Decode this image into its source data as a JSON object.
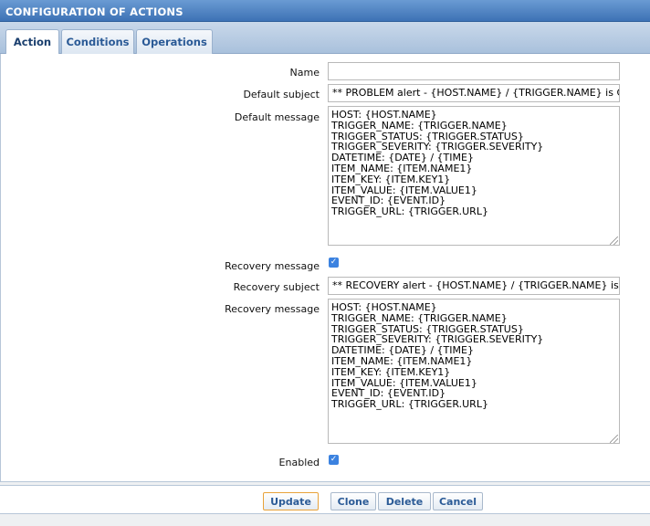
{
  "header": {
    "title": "CONFIGURATION OF ACTIONS"
  },
  "tabs": [
    {
      "label": "Action",
      "active": true
    },
    {
      "label": "Conditions",
      "active": false
    },
    {
      "label": "Operations",
      "active": false
    }
  ],
  "form": {
    "name": {
      "label": "Name",
      "value": ""
    },
    "default_subject": {
      "label": "Default subject",
      "value": "** PROBLEM alert - {HOST.NAME} / {TRIGGER.NAME} is CRI"
    },
    "default_message": {
      "label": "Default message",
      "value": "HOST: {HOST.NAME}\nTRIGGER_NAME: {TRIGGER.NAME}\nTRIGGER_STATUS: {TRIGGER.STATUS}\nTRIGGER_SEVERITY: {TRIGGER.SEVERITY}\nDATETIME: {DATE} / {TIME}\nITEM_NAME: {ITEM.NAME1}\nITEM_KEY: {ITEM.KEY1}\nITEM_VALUE: {ITEM.VALUE1}\nEVENT_ID: {EVENT.ID}\nTRIGGER_URL: {TRIGGER.URL}"
    },
    "recovery_message_toggle": {
      "label": "Recovery message",
      "checked": true
    },
    "recovery_subject": {
      "label": "Recovery subject",
      "value": "** RECOVERY alert - {HOST.NAME} / {TRIGGER.NAME} is OK"
    },
    "recovery_message": {
      "label": "Recovery message",
      "value": "HOST: {HOST.NAME}\nTRIGGER_NAME: {TRIGGER.NAME}\nTRIGGER_STATUS: {TRIGGER.STATUS}\nTRIGGER_SEVERITY: {TRIGGER.SEVERITY}\nDATETIME: {DATE} / {TIME}\nITEM_NAME: {ITEM.NAME1}\nITEM_KEY: {ITEM.KEY1}\nITEM_VALUE: {ITEM.VALUE1}\nEVENT_ID: {EVENT.ID}\nTRIGGER_URL: {TRIGGER.URL}"
    },
    "enabled": {
      "label": "Enabled",
      "checked": true
    },
    "checkmark_glyph": "✓"
  },
  "buttons": {
    "update": "Update",
    "clone": "Clone",
    "delete": "Delete",
    "cancel": "Cancel"
  },
  "colors": {
    "header_blue": "#3d72b5",
    "link_blue": "#2a5a96",
    "checkbox_blue": "#3b82e0",
    "primary_border": "#e8a23a"
  }
}
